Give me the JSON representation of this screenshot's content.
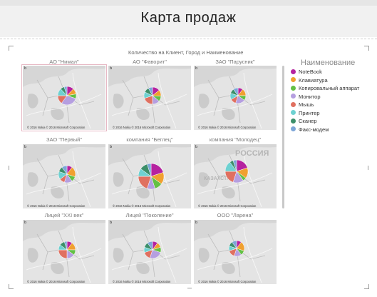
{
  "page": {
    "title": "Карта продаж"
  },
  "visual": {
    "title": "Количество на Клиент, Город и Наименование",
    "map_attribution": "© 2016 Nokia  © 2016 Microsoft Corporation",
    "bing_logo": "b"
  },
  "legend": {
    "title": "Наименование",
    "items": [
      {
        "label": "NoteBook",
        "color": "#b5229f"
      },
      {
        "label": "Клавиатура",
        "color": "#f0a030"
      },
      {
        "label": "Копировальный аппарат",
        "color": "#63c044"
      },
      {
        "label": "Монитор",
        "color": "#b59fe0"
      },
      {
        "label": "Мышь",
        "color": "#e07060"
      },
      {
        "label": "Принтер",
        "color": "#6ed1d1"
      },
      {
        "label": "Сканер",
        "color": "#3c8f6a"
      },
      {
        "label": "Факс-модем",
        "color": "#7da6d8"
      }
    ]
  },
  "panels": [
    {
      "label": "АО \"Нимал\"",
      "selected": true,
      "slices": [
        0.12,
        0.1,
        0.08,
        0.3,
        0.15,
        0.13,
        0.07,
        0.05
      ],
      "map_text": ""
    },
    {
      "label": "АО \"Фаворит\"",
      "selected": false,
      "slices": [
        0.14,
        0.12,
        0.1,
        0.14,
        0.2,
        0.12,
        0.1,
        0.08
      ],
      "map_text": ""
    },
    {
      "label": "ЗАО \"Парусник\"",
      "selected": false,
      "slices": [
        0.1,
        0.15,
        0.1,
        0.2,
        0.12,
        0.13,
        0.1,
        0.1
      ],
      "map_text": ""
    },
    {
      "label": "ЗАО \"Первый\"",
      "selected": false,
      "slices": [
        0.1,
        0.2,
        0.1,
        0.15,
        0.1,
        0.15,
        0.1,
        0.1
      ],
      "map_text": ""
    },
    {
      "label": "компания \"Беглец\"",
      "selected": false,
      "slices": [
        0.2,
        0.15,
        0.1,
        0.1,
        0.2,
        0.1,
        0.1,
        0.05
      ],
      "map_text": ""
    },
    {
      "label": "компания \"Молодец\"",
      "selected": false,
      "slices": [
        0.2,
        0.15,
        0.05,
        0.15,
        0.2,
        0.15,
        0.05,
        0.05
      ],
      "map_text": "РОССИЯ",
      "map_text2": "КАЗАХСТАН"
    },
    {
      "label": "Лицей \"XXI век\"",
      "selected": false,
      "slices": [
        0.1,
        0.15,
        0.1,
        0.15,
        0.25,
        0.1,
        0.1,
        0.05
      ],
      "map_text": ""
    },
    {
      "label": "Лицей \"Поколение\"",
      "selected": false,
      "slices": [
        0.1,
        0.1,
        0.1,
        0.25,
        0.15,
        0.1,
        0.1,
        0.1
      ],
      "map_text": ""
    },
    {
      "label": "ООО \"Ларена\"",
      "selected": false,
      "slices": [
        0.1,
        0.2,
        0.1,
        0.15,
        0.15,
        0.1,
        0.1,
        0.1
      ],
      "map_text": ""
    }
  ]
}
